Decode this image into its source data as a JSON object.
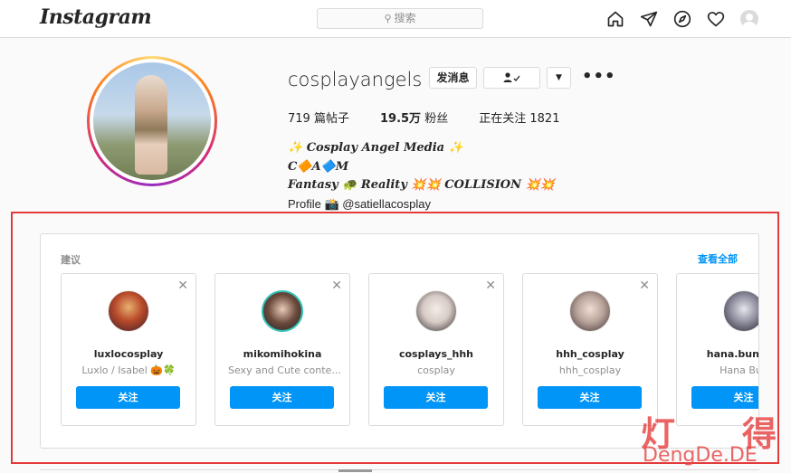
{
  "header": {
    "logo": "Instagram",
    "search_placeholder": "搜索",
    "nav_icons": [
      "home-icon",
      "send-icon",
      "explore-icon",
      "heart-icon",
      "profile-avatar"
    ]
  },
  "profile": {
    "username": "cosplayangels",
    "message_button": "发消息",
    "following_button_icon": "person-check-icon",
    "more_dropdown_icon": "chevron-down-icon",
    "options_icon": "more-icon",
    "stats": {
      "posts_value": "719",
      "posts_label": "篇帖子",
      "followers_value": "19.5万",
      "followers_label": "粉丝",
      "following_label": "正在关注",
      "following_value": "1821"
    },
    "bio": [
      "✨ Cosplay Angel Media ✨",
      "C🔶A🔷M",
      "Fantasy 🐢 Reality 💥💥 COLLISION 💥💥",
      "Profile 📸 @satiellacosplay"
    ]
  },
  "suggestions": {
    "title": "建议",
    "see_all": "查看全部",
    "follow_label": "关注",
    "cards": [
      {
        "name": "luxlocosplay",
        "sub": "Luxlo / Isabel 🎃🍀"
      },
      {
        "name": "mikomihokina",
        "sub": "Sexy and Cute conte..."
      },
      {
        "name": "cosplays_hhh",
        "sub": "cosplay"
      },
      {
        "name": "hhh_cosplay",
        "sub": "hhh_cosplay"
      },
      {
        "name": "hana.bunny_l",
        "sub": "Hana Bun"
      }
    ]
  },
  "watermark": {
    "top_left": "灯",
    "top_right": "得",
    "bottom": "DengDe.DE"
  },
  "colors": {
    "accent": "#0095f6",
    "highlight_border": "#e33b3b",
    "watermark": "#e84a4a"
  }
}
